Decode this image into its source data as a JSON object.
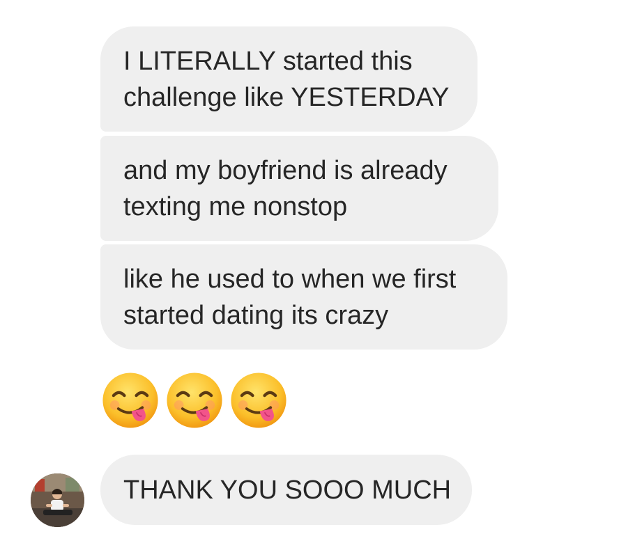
{
  "conversation": {
    "messages": [
      {
        "lines": [
          "I LITERALLY started this",
          "challenge like YESTERDAY"
        ]
      },
      {
        "lines": [
          "and my boyfriend is already",
          "texting me nonstop"
        ]
      },
      {
        "lines": [
          "like he used to when we first",
          "started dating its crazy"
        ]
      },
      {
        "emoji": [
          "face-savoring-food-icon",
          "face-savoring-food-icon",
          "face-savoring-food-icon"
        ]
      },
      {
        "lines": [
          "THANK YOU SOOO MUCH"
        ]
      }
    ],
    "sender_avatar": "profile-photo"
  },
  "colors": {
    "bubble_background": "#efefef",
    "text": "#262626",
    "background": "#ffffff"
  }
}
